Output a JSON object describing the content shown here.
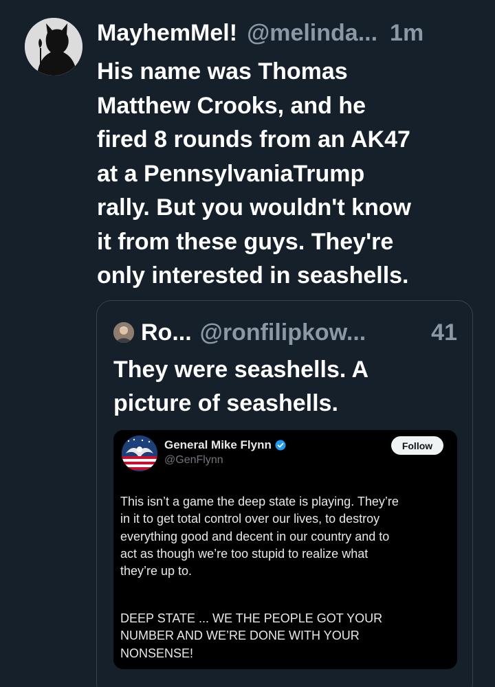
{
  "post": {
    "author_name": "MayhemMel!",
    "author_handle": "@melinda...",
    "time": "1m",
    "avatar_icon": "silhouette-avatar",
    "text": "His name was Thomas\nMatthew Crooks, and he\nfired 8 rounds from an AK47\nat a PennsylvaniaTrump\nrally. But you wouldn't know\nit from these guys. They're\nonly interested in seashells."
  },
  "quote": {
    "author_name": "Ro...",
    "author_handle": "@ronfilipkow...",
    "time": "41",
    "avatar_icon": "person-avatar",
    "text": "They were seashells. A\npicture of seashells.",
    "embedded": {
      "author_name": "General Mike Flynn",
      "author_handle": "@GenFlynn",
      "verified_icon": "verified-badge-icon",
      "verified_color": "#1d9bf0",
      "follow_label": "Follow",
      "avatar_icon": "eagle-flag-avatar",
      "body_paragraph_1": "This isn’t a game the deep state is playing. They’re\nin it to get total control over our lives, to destroy\neverything good and decent in our country and to\nact as though we’re too stupid to realize what\nthey’re up to.",
      "body_paragraph_2": "DEEP STATE ... WE THE PEOPLE GOT YOUR\nNUMBER AND WE’RE DONE WITH YOUR\nNONSENSE!"
    }
  },
  "colors": {
    "background": "#15202b",
    "text_primary": "#ffffff",
    "text_secondary": "#8b98a5",
    "border": "#38444d",
    "embedded_background": "#000000"
  }
}
